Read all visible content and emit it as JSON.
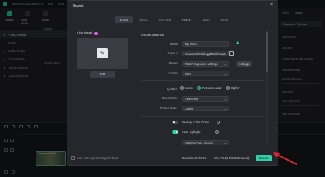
{
  "app": {
    "title": "Wondershare Filmora",
    "menu": [
      "File",
      "Edit"
    ]
  },
  "left_panel": {
    "tabs": [
      {
        "label": "Media",
        "active": true
      },
      {
        "label": "Stock Media",
        "active": false
      },
      {
        "label": "Audio",
        "active": false
      }
    ],
    "items": [
      {
        "label": "Project Media",
        "selected": true
      },
      {
        "label": "Folder",
        "selected": false
      },
      {
        "label": "Global Media",
        "selected": false
      },
      {
        "label": "Cloud Media",
        "selected": false
      },
      {
        "label": "Adjustment La...",
        "selected": false
      },
      {
        "label": "Compound Clip",
        "selected": false
      }
    ],
    "media_texts": [
      "Import",
      "Import Media"
    ]
  },
  "right_panel": {
    "tabs": [
      "Video",
      "Audio"
    ],
    "chip": "Frameset Cel Video",
    "rows": [
      "Adjustment",
      "Denoise",
      "AI Speech Enhancement",
      "Wind Removal",
      "Normal Denoise",
      "Dereverb",
      "Hum Removal",
      "Hiss Removal"
    ]
  },
  "timeline": {
    "clip_label": "Frameset Cel Vid"
  },
  "dialog": {
    "title": "Export",
    "close": "✕",
    "tabs": [
      {
        "label": "Local",
        "active": true
      },
      {
        "label": "Device",
        "active": false
      },
      {
        "label": "YouTube",
        "active": false
      },
      {
        "label": "TikTok",
        "active": false
      },
      {
        "label": "Vimeo",
        "active": false
      },
      {
        "label": "DVD",
        "active": false
      }
    ],
    "thumbnail_label": "Thumbnail",
    "thumbnail_badge": "AI",
    "edit_label": "Edit",
    "output_settings": "Output Settings",
    "name_label": "Name",
    "name_value": "My Video",
    "save_to_label": "Save to",
    "save_to_value": "C:/Users/WS2/AppData/Roam",
    "preset_label": "Preset",
    "preset_value": "Match to project settings",
    "settings_label": "Settings",
    "format_label": "Format",
    "format_value": "MP4",
    "quality_label": "Quality",
    "quality_options": [
      {
        "label": "Lower",
        "selected": false
      },
      {
        "label": "Recommendar",
        "selected": true
      },
      {
        "label": "Higher",
        "selected": false
      }
    ],
    "resolution_label": "Resolution",
    "resolution_value": "1280x720",
    "frame_rate_label": "Frame Rate",
    "frame_rate_value": "25 fps",
    "backup_label": "Backup to the Cloud",
    "backup_on": false,
    "auto_highlight_label": "Auto Highlight",
    "auto_highlight_on": true,
    "highlight_value": "60s(YouTube Shorts)",
    "footer_note": "Use last export settings for local",
    "duration": "Duration:00:00:30",
    "size": "Size:75.22 MB(Estimated)",
    "export_label": "Export"
  },
  "colors": {
    "accent": "#2fd0a8",
    "dialog_bg": "#25272d",
    "arrow": "#e0262c"
  }
}
